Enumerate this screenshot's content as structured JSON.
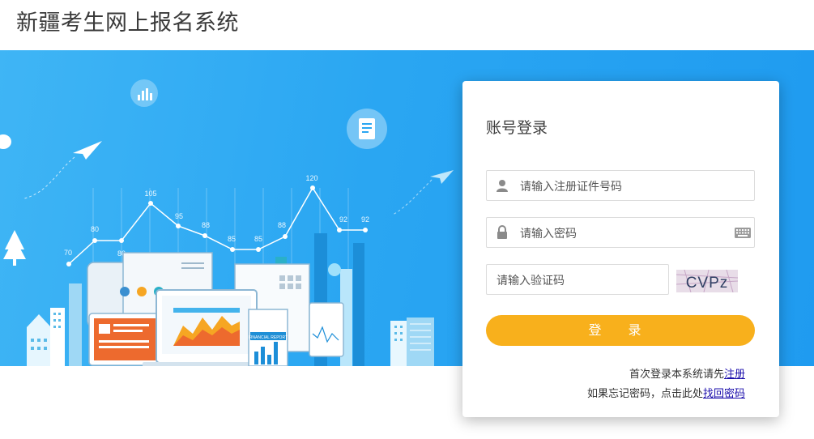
{
  "header": {
    "title": "新疆考生网上报名系统"
  },
  "login": {
    "title": "账号登录",
    "id_placeholder": "请输入注册证件号码",
    "password_placeholder": "请输入密码",
    "captcha_placeholder": "请输入验证码",
    "captcha_text": "CVPz",
    "submit_label": "登 录",
    "register_prompt": "首次登录本系统请先",
    "register_link": "注册",
    "forgot_prompt": "如果忘记密码，点击此处",
    "forgot_link": "找回密码"
  },
  "banner_chart": {
    "labels": [
      "70",
      "80",
      "80",
      "105",
      "95",
      "88",
      "85",
      "85",
      "88",
      "120",
      "92",
      "92"
    ],
    "report_label": "FINANCIAL REPORT"
  },
  "colors": {
    "banner": "#2aa6f2",
    "button": "#f8b01c",
    "link": "#1a0dab"
  },
  "icons": [
    "user-icon",
    "lock-icon",
    "keyboard-icon",
    "bar-chart-icon",
    "document-icon",
    "paper-plane-icon",
    "tree-icon"
  ]
}
